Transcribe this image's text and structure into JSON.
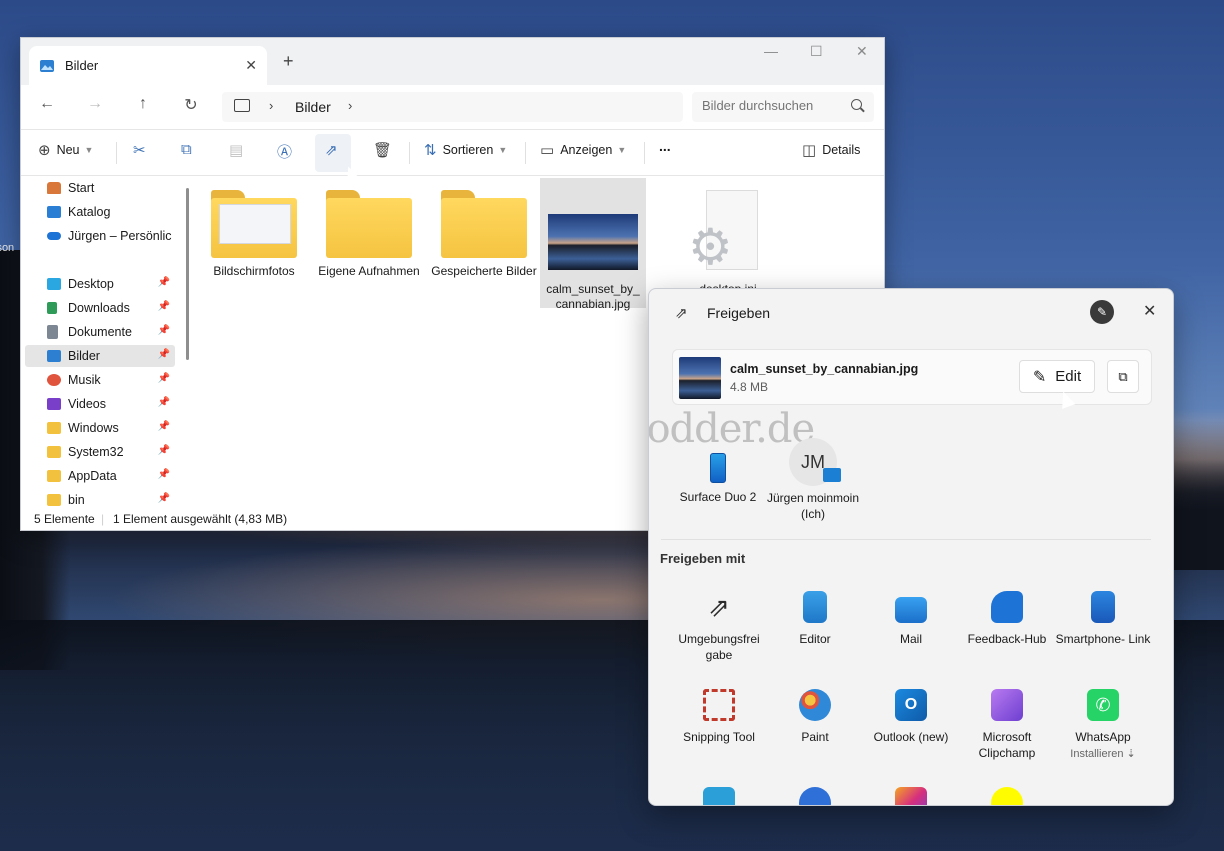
{
  "explorer": {
    "tab_title": "Bilder",
    "path": [
      "Bilder"
    ],
    "search_placeholder": "Bilder durchsuchen",
    "toolbar": {
      "new_label": "Neu",
      "sort_label": "Sortieren",
      "view_label": "Anzeigen",
      "more_label": "...",
      "details_label": "Details"
    },
    "sidebar": [
      {
        "label": "Start",
        "icon": "home-icon",
        "pinned": false,
        "color": "#d9773a"
      },
      {
        "label": "Katalog",
        "icon": "gallery-icon",
        "pinned": false,
        "color": "#2a7fd4"
      },
      {
        "label": "Jürgen – Persönlic",
        "icon": "onedrive-icon",
        "pinned": false,
        "color": "#1e74d6"
      },
      {
        "label": "Desktop",
        "icon": "desktop-icon",
        "pinned": true,
        "color": "#2aa7e0"
      },
      {
        "label": "Downloads",
        "icon": "download-icon",
        "pinned": true,
        "color": "#2f9b58"
      },
      {
        "label": "Dokumente",
        "icon": "documents-icon",
        "pinned": true,
        "color": "#7d8794"
      },
      {
        "label": "Bilder",
        "icon": "pictures-icon",
        "pinned": true,
        "color": "#2c7fd1"
      },
      {
        "label": "Musik",
        "icon": "music-icon",
        "pinned": true,
        "color": "#e0533d"
      },
      {
        "label": "Videos",
        "icon": "videos-icon",
        "pinned": true,
        "color": "#7a3fc8"
      },
      {
        "label": "Windows",
        "icon": "folder-icon",
        "pinned": true,
        "color": "#f2c13d"
      },
      {
        "label": "System32",
        "icon": "folder-icon",
        "pinned": true,
        "color": "#f2c13d"
      },
      {
        "label": "AppData",
        "icon": "folder-icon",
        "pinned": true,
        "color": "#f2c13d"
      },
      {
        "label": "bin",
        "icon": "folder-icon",
        "pinned": true,
        "color": "#f2c13d"
      }
    ],
    "files": [
      {
        "name": "Bildschirmfotos",
        "kind": "folder-with-paper"
      },
      {
        "name": "Eigene Aufnahmen",
        "kind": "folder"
      },
      {
        "name": "Gespeicherte Bilder",
        "kind": "folder"
      },
      {
        "name": "calm_sunset_by_ cannabian.jpg",
        "kind": "image",
        "selected": true
      },
      {
        "name": "desktop.ini",
        "kind": "ini"
      }
    ],
    "status": {
      "count": "5 Elemente",
      "selection": "1 Element ausgewählt (4,83 MB)"
    }
  },
  "share": {
    "title": "Freigeben",
    "file_name": "calm_sunset_by_cannabian.jpg",
    "file_size": "4.8 MB",
    "edit_label": "Edit",
    "watermark": "Deskmodder.de",
    "contacts": [
      {
        "name": "Surface Duo 2",
        "icon": "phone-icon"
      },
      {
        "name": "Jürgen moinmoin (Ich)",
        "initials": "JM",
        "icon": "avatar"
      }
    ],
    "share_with_label": "Freigeben mit",
    "apps": [
      {
        "name": "Umgebungsfrei gabe",
        "icon": "nearby-share-icon",
        "color": "#2b2b2b"
      },
      {
        "name": "Editor",
        "icon": "notepad-icon",
        "color": "#2d8fd8"
      },
      {
        "name": "Mail",
        "icon": "mail-icon",
        "color": "#1b7fd3"
      },
      {
        "name": "Feedback-Hub",
        "icon": "feedback-hub-icon",
        "color": "#1e74d6"
      },
      {
        "name": "Smartphone- Link",
        "icon": "phone-link-icon",
        "color": "#2062c4"
      },
      {
        "name": "Snipping Tool",
        "icon": "snipping-tool-icon",
        "color": "#c0392b"
      },
      {
        "name": "Paint",
        "icon": "paint-icon",
        "color": "#2f89d8"
      },
      {
        "name": "Outlook (new)",
        "icon": "outlook-icon",
        "color": "#0f6cbd"
      },
      {
        "name": "Microsoft Clipchamp",
        "icon": "clipchamp-icon",
        "color": "#8b5bd6"
      },
      {
        "name": "WhatsApp",
        "sub": "Installieren ⇣",
        "icon": "whatsapp-icon",
        "color": "#25d366"
      }
    ],
    "more_app_icons": [
      {
        "icon": "telegram-icon",
        "color": "#2a9fd8"
      },
      {
        "icon": "app-icon",
        "color": "#2f6fd8"
      },
      {
        "icon": "instagram-icon",
        "color": "#d62f7d"
      },
      {
        "icon": "snapchat-icon",
        "color": "#fffc00"
      }
    ]
  },
  "desktop_fragment": "json"
}
